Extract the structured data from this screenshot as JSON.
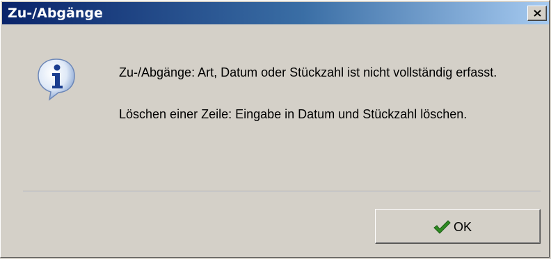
{
  "window": {
    "title": "Zu-/Abgänge",
    "close_icon": "close-icon"
  },
  "dialog": {
    "icon": "info-icon",
    "message_line1": "Zu-/Abgänge: Art, Datum oder Stückzahl ist nicht vollständig erfasst.",
    "message_line2": "Löschen einer Zeile: Eingabe in Datum und Stückzahl löschen."
  },
  "buttons": {
    "ok_label": "OK",
    "ok_icon": "check-icon"
  },
  "colors": {
    "titlebar_start": "#0a246a",
    "titlebar_end": "#a6caf0",
    "window_face": "#d4d0c8",
    "check_green": "#2e8b22"
  }
}
